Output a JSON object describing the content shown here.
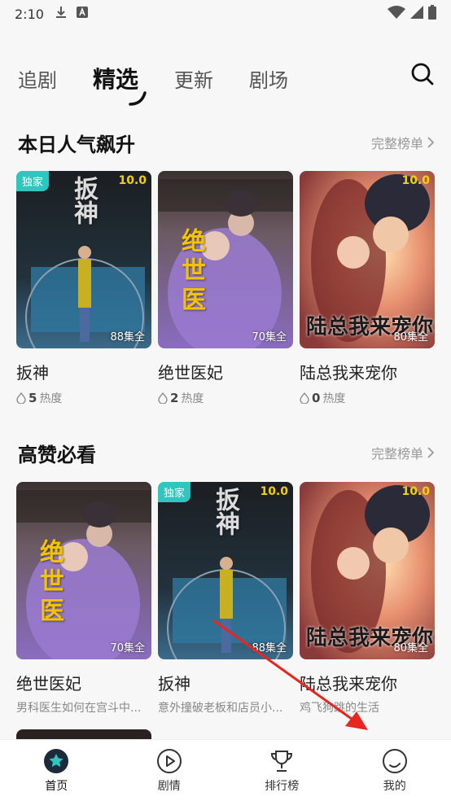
{
  "status": {
    "time": "2:10"
  },
  "topnav": {
    "tabs": [
      {
        "label": "追剧"
      },
      {
        "label": "精选"
      },
      {
        "label": "更新"
      },
      {
        "label": "剧场"
      }
    ]
  },
  "sections": [
    {
      "title": "本日人气飙升",
      "more": "完整榜单",
      "cards": [
        {
          "name": "扳神",
          "badge": "独家",
          "score": "10.0",
          "episodes": "88集全",
          "heat_value": "5",
          "heat_label": "热度"
        },
        {
          "name": "绝世医妃",
          "badge": "",
          "score": "",
          "episodes": "70集全",
          "heat_value": "2",
          "heat_label": "热度"
        },
        {
          "name": "陆总我来宠你",
          "badge": "",
          "score": "10.0",
          "episodes": "80集全",
          "heat_value": "0",
          "heat_label": "热度"
        }
      ]
    },
    {
      "title": "高赞必看",
      "more": "完整榜单",
      "cards": [
        {
          "name": "绝世医妃",
          "badge": "",
          "score": "",
          "episodes": "70集全",
          "desc": "男科医生如何在宫斗中..."
        },
        {
          "name": "扳神",
          "badge": "独家",
          "score": "10.0",
          "episodes": "88集全",
          "desc": "意外撞破老板和店员小..."
        },
        {
          "name": "陆总我来宠你",
          "badge": "",
          "score": "10.0",
          "episodes": "80集全",
          "desc": "鸡飞狗跳的生活"
        }
      ]
    }
  ],
  "poster_text": {
    "yishi": "绝世医",
    "luzong": "陆总我来宠你"
  },
  "bottomnav": {
    "items": [
      {
        "label": "首页"
      },
      {
        "label": "剧情"
      },
      {
        "label": "排行榜"
      },
      {
        "label": "我的"
      }
    ]
  },
  "colors": {
    "accent": "#2ec7c0",
    "score": "#f5d000",
    "arrow": "#e8261f"
  }
}
